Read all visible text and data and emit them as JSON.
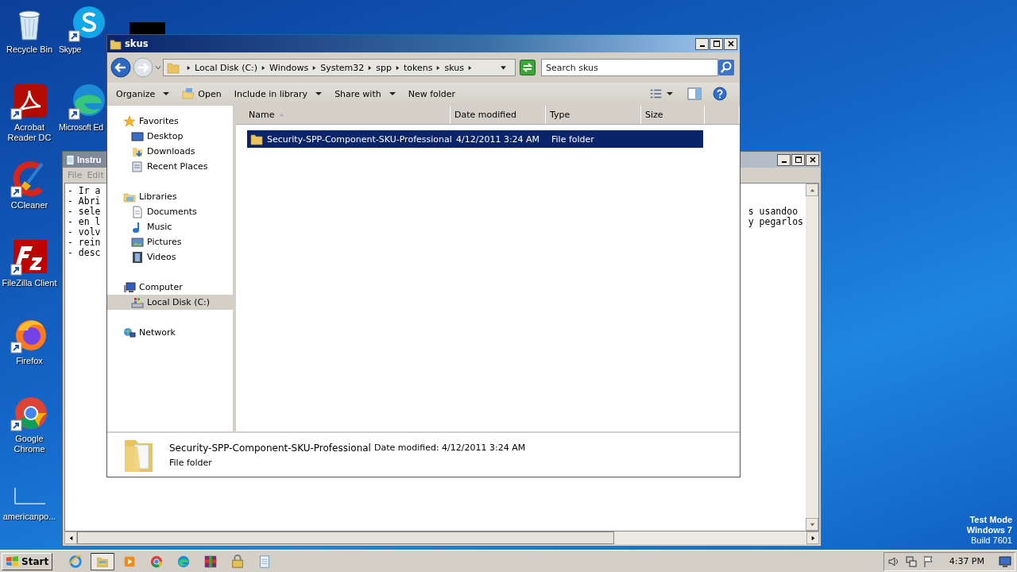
{
  "desktop": {
    "columns": [
      [
        {
          "label": "Recycle Bin",
          "kind": "recycle",
          "shortcut": false
        },
        {
          "label": "Acrobat Reader DC",
          "kind": "acrobat",
          "shortcut": true
        },
        {
          "label": "CCleaner",
          "kind": "ccleaner",
          "shortcut": true
        },
        {
          "label": "FileZilla Client",
          "kind": "filezilla",
          "shortcut": true
        },
        {
          "label": "Firefox",
          "kind": "firefox",
          "shortcut": true
        },
        {
          "label": "Google Chrome",
          "kind": "chrome",
          "shortcut": true
        },
        {
          "label": "americanpo...",
          "kind": "file",
          "shortcut": false
        }
      ],
      [
        {
          "label": "Skype",
          "kind": "skype",
          "shortcut": true
        },
        {
          "label": "Microsoft Ed",
          "kind": "edge",
          "shortcut": true
        }
      ]
    ],
    "system_text": [
      "Test Mode",
      "Windows 7",
      "Build 7601"
    ]
  },
  "notepad": {
    "title": "Instru",
    "menu": [
      "File",
      "Edit"
    ],
    "lines": [
      {
        "left": "- Ir a"
      },
      {
        "left": "- Abri"
      },
      {
        "left": "- sele",
        "right": "s usandoo"
      },
      {
        "left": "- en l",
        "right": "y pegarlos"
      },
      {
        "left": "- volv"
      },
      {
        "left": "- rein"
      },
      {
        "left": "- desc"
      }
    ]
  },
  "explorer": {
    "title": "skus",
    "breadcrumb": [
      "Local Disk (C:)",
      "Windows",
      "System32",
      "spp",
      "tokens",
      "skus"
    ],
    "search": {
      "placeholder": "Search skus"
    },
    "toolbar": [
      {
        "label": "Organize",
        "kind": "menu"
      },
      {
        "label": "Open",
        "kind": "open"
      },
      {
        "label": "Include in library",
        "kind": "menu"
      },
      {
        "label": "Share with",
        "kind": "menu"
      },
      {
        "label": "New folder",
        "kind": "plain"
      }
    ],
    "nav": [
      {
        "label": "Favorites",
        "kind": "star",
        "selected": false,
        "children": [
          {
            "label": "Desktop",
            "kind": "desktop",
            "selected": false
          },
          {
            "label": "Downloads",
            "kind": "downloads",
            "selected": false
          },
          {
            "label": "Recent Places",
            "kind": "recent",
            "selected": false
          }
        ]
      },
      {
        "label": "Libraries",
        "kind": "libraries",
        "selected": false,
        "children": [
          {
            "label": "Documents",
            "kind": "documents",
            "selected": false
          },
          {
            "label": "Music",
            "kind": "music",
            "selected": false
          },
          {
            "label": "Pictures",
            "kind": "pictures",
            "selected": false
          },
          {
            "label": "Videos",
            "kind": "videos",
            "selected": false
          }
        ]
      },
      {
        "label": "Computer",
        "kind": "computer",
        "selected": false,
        "children": [
          {
            "label": "Local Disk (C:)",
            "kind": "disk",
            "selected": true
          }
        ]
      },
      {
        "label": "Network",
        "kind": "network",
        "selected": false
      }
    ],
    "columns": [
      {
        "label": "Name",
        "sorted": true
      },
      {
        "label": "Date modified",
        "sorted": false
      },
      {
        "label": "Type",
        "sorted": false
      },
      {
        "label": "Size",
        "sorted": false
      }
    ],
    "rows": [
      {
        "name": "Security-SPP-Component-SKU-Professional",
        "date": "4/12/2011 3:24 AM",
        "type": "File folder",
        "selected": true
      }
    ],
    "details": {
      "name": "Security-SPP-Component-SKU-Professional",
      "meta": "Date modified: 4/12/2011 3:24 AM",
      "type": "File folder"
    }
  },
  "taskbar": {
    "start": "Start",
    "items": [
      {
        "kind": "ie",
        "active": false
      },
      {
        "kind": "explorer",
        "active": true
      },
      {
        "kind": "media",
        "active": false
      },
      {
        "kind": "chrome",
        "active": false
      },
      {
        "kind": "edge",
        "active": false
      },
      {
        "kind": "winrar",
        "active": false
      },
      {
        "kind": "lock",
        "active": false
      },
      {
        "kind": "notepad",
        "active": false
      }
    ],
    "clock": "4:37 PM"
  }
}
